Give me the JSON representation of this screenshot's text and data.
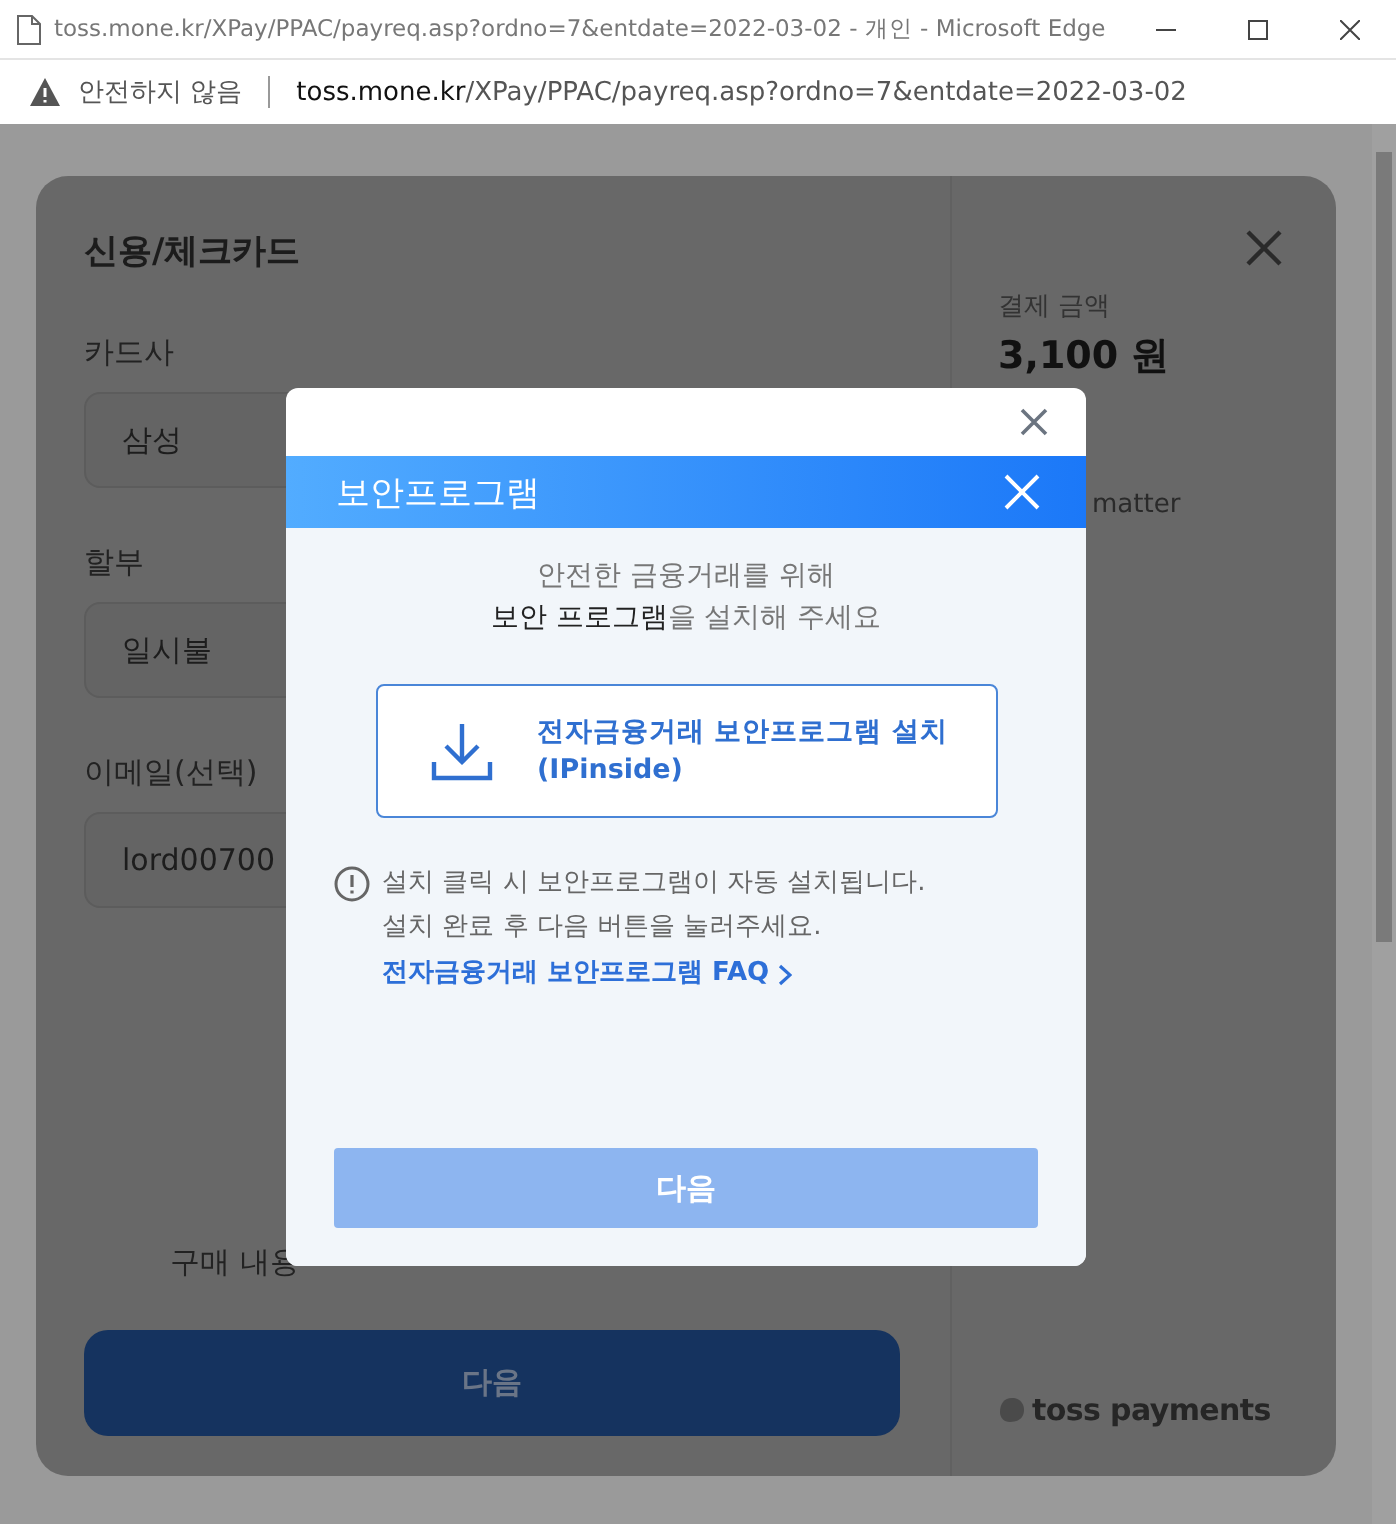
{
  "window": {
    "title": "toss.mone.kr/XPay/PPAC/payreq.asp?ordno=7&entdate=2022-03-02 - 개인 - Microsoft Edge"
  },
  "address_bar": {
    "security": "안전하지 않음",
    "url_host": "toss.mone.kr",
    "url_path": "/XPay/PPAC/payreq.asp?ordno=7&entdate=2022-03-02"
  },
  "payment_form": {
    "title": "신용/체크카드",
    "fields": [
      {
        "label": "카드사",
        "value": "삼성"
      },
      {
        "label": "할부",
        "value": "일시불"
      },
      {
        "label": "이메일(선택)",
        "value": "lord00700"
      }
    ],
    "purchase_label": "구매 내용",
    "next_button": "다음",
    "amount_label": "결제 금액",
    "amount": "3,100 원",
    "item_fragment": "matter",
    "brand": "toss payments"
  },
  "security_dialog": {
    "title": "보안프로그램",
    "message": [
      "안전한 금융거래를 위해",
      "**보안 프로그램**을 설치해 주세요"
    ],
    "install_button": [
      "전자금융거래 보안프로그램 설치",
      "(IPinside)"
    ],
    "notes": [
      "설치 클릭 시 보안프로그램이 자동 설치됩니다.",
      "설치 완료 후 다음 버튼을 눌러주세요."
    ],
    "faq_link": "전자금융거래 보안프로그램 FAQ",
    "next_button": {
      "label": "다음",
      "disabled": true
    }
  }
}
